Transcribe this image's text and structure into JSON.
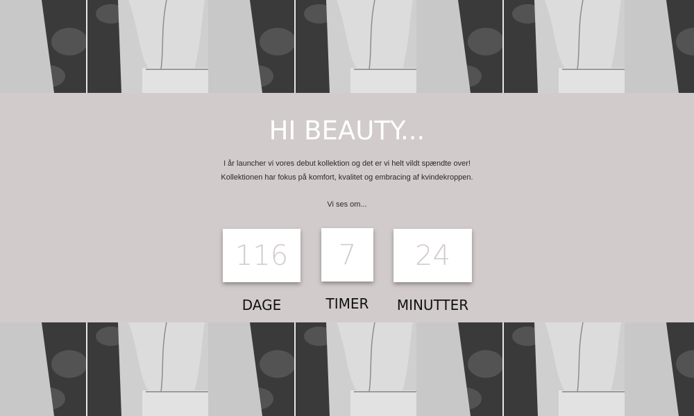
{
  "hero": {
    "title": "HI BEAUTY...",
    "intro_line_1": "I år launcher vi vores debut kollektion og det er vi helt vildt spændte over!",
    "intro_line_2": "Kollektionen har fokus på komfort, kvalitet og embracing af kvindekroppen.",
    "see_you": "Vi ses om..."
  },
  "countdown": {
    "days": {
      "value": "116",
      "label": "DAGE"
    },
    "hours": {
      "value": "7",
      "label": "TIMER"
    },
    "minutes": {
      "value": "24",
      "label": "MINUTTER"
    }
  },
  "colors": {
    "background": "#d2cbcb",
    "title": "#ffffff",
    "counter_digits": "#d2cbcb",
    "label_text": "#111111"
  },
  "images": {
    "top_banner": "model-photo-repeat",
    "bottom_banner": "model-photo-repeat"
  }
}
